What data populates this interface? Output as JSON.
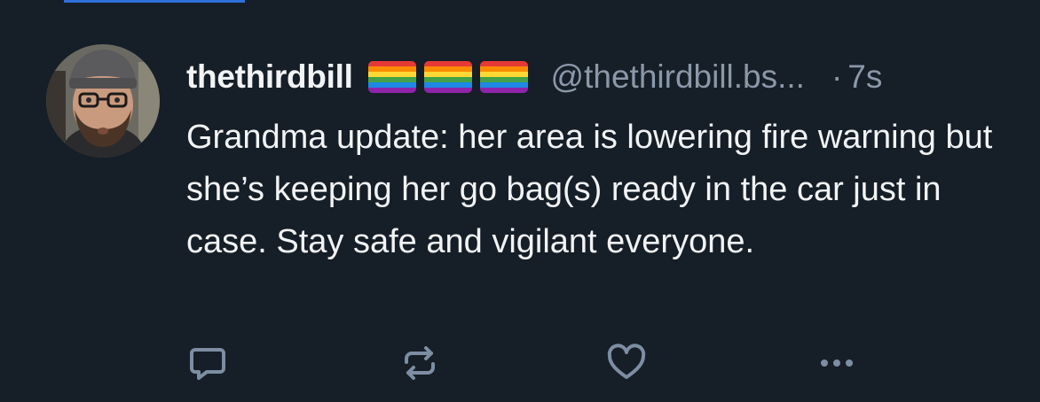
{
  "post": {
    "author": {
      "display_name": "thethirdbill",
      "flags": [
        "rainbow-flag",
        "rainbow-flag",
        "rainbow-flag"
      ],
      "handle": "@thethirdbill.bs...",
      "avatar": "avatar-photo"
    },
    "separator": "·",
    "timestamp": "7s",
    "text": "Grandma update: her area is lowering fire warning but she’s keeping her go bag(s) ready in the car just in case. Stay safe and vigilant everyone.",
    "actions": {
      "reply_icon": "reply-icon",
      "repost_icon": "repost-icon",
      "like_icon": "heart-icon",
      "more_icon": "more-options-icon"
    }
  },
  "colors": {
    "background": "#161e27",
    "text_primary": "#f1f3f5",
    "text_secondary": "#8b98a8",
    "icon": "#7d8ea3",
    "accent": "#2f6fd8"
  }
}
